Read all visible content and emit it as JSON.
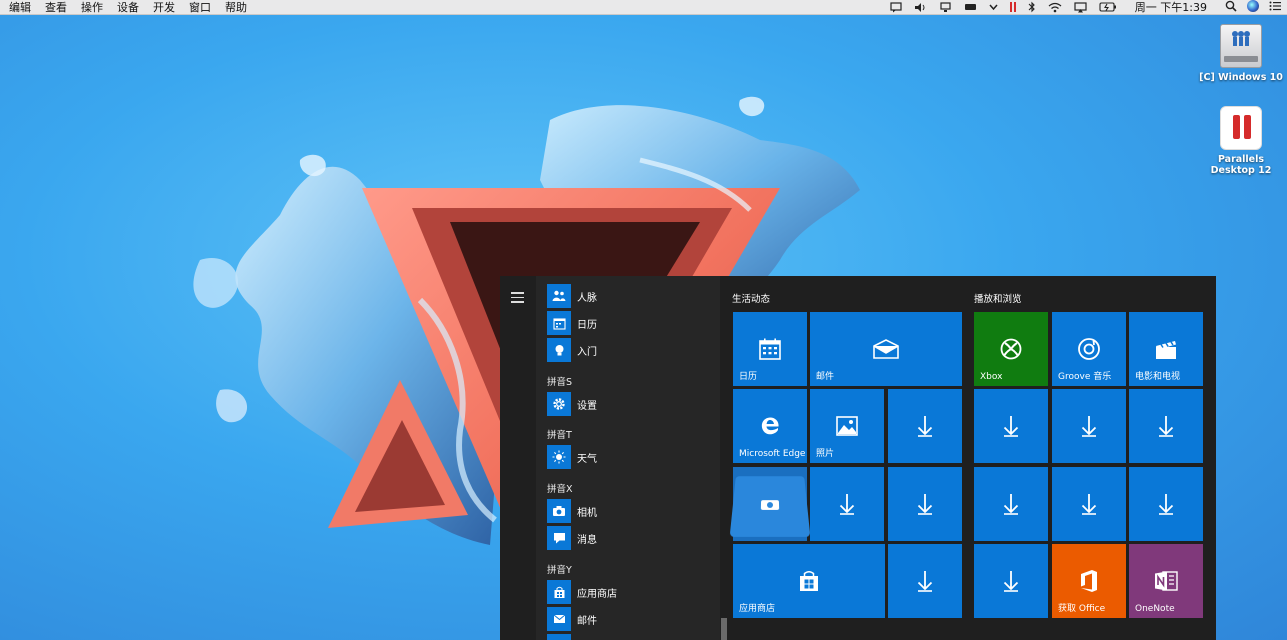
{
  "menubar": {
    "menus": [
      "编辑",
      "查看",
      "操作",
      "设备",
      "开发",
      "窗口",
      "帮助"
    ],
    "clock": "周一 下午1:39"
  },
  "desktop": {
    "icons": [
      {
        "label": "[C] Windows 10"
      },
      {
        "label": "Parallels Desktop 12"
      }
    ]
  },
  "start_menu": {
    "app_list": {
      "headers": {
        "s": "拼音S",
        "t": "拼音T",
        "x": "拼音X",
        "y": "拼音Y"
      },
      "apps": {
        "people": "人脉",
        "calendar": "日历",
        "getstarted": "入门",
        "settings": "设置",
        "weather": "天气",
        "camera": "相机",
        "messaging": "消息",
        "store": "应用商店",
        "mail": "邮件"
      }
    },
    "groups": {
      "life": "生活动态",
      "play": "播放和浏览"
    },
    "tiles": {
      "calendar": "日历",
      "mail": "邮件",
      "edge": "Microsoft Edge",
      "photos": "照片",
      "store": "应用商店",
      "xbox": "Xbox",
      "groove": "Groove 音乐",
      "movies": "电影和电视",
      "office": "获取 Office",
      "onenote": "OneNote"
    },
    "colors": {
      "tile_blue": "#0a78d7",
      "xbox_green": "#107c10",
      "office_orange": "#eb5b00",
      "onenote_purple": "#80397b"
    }
  }
}
